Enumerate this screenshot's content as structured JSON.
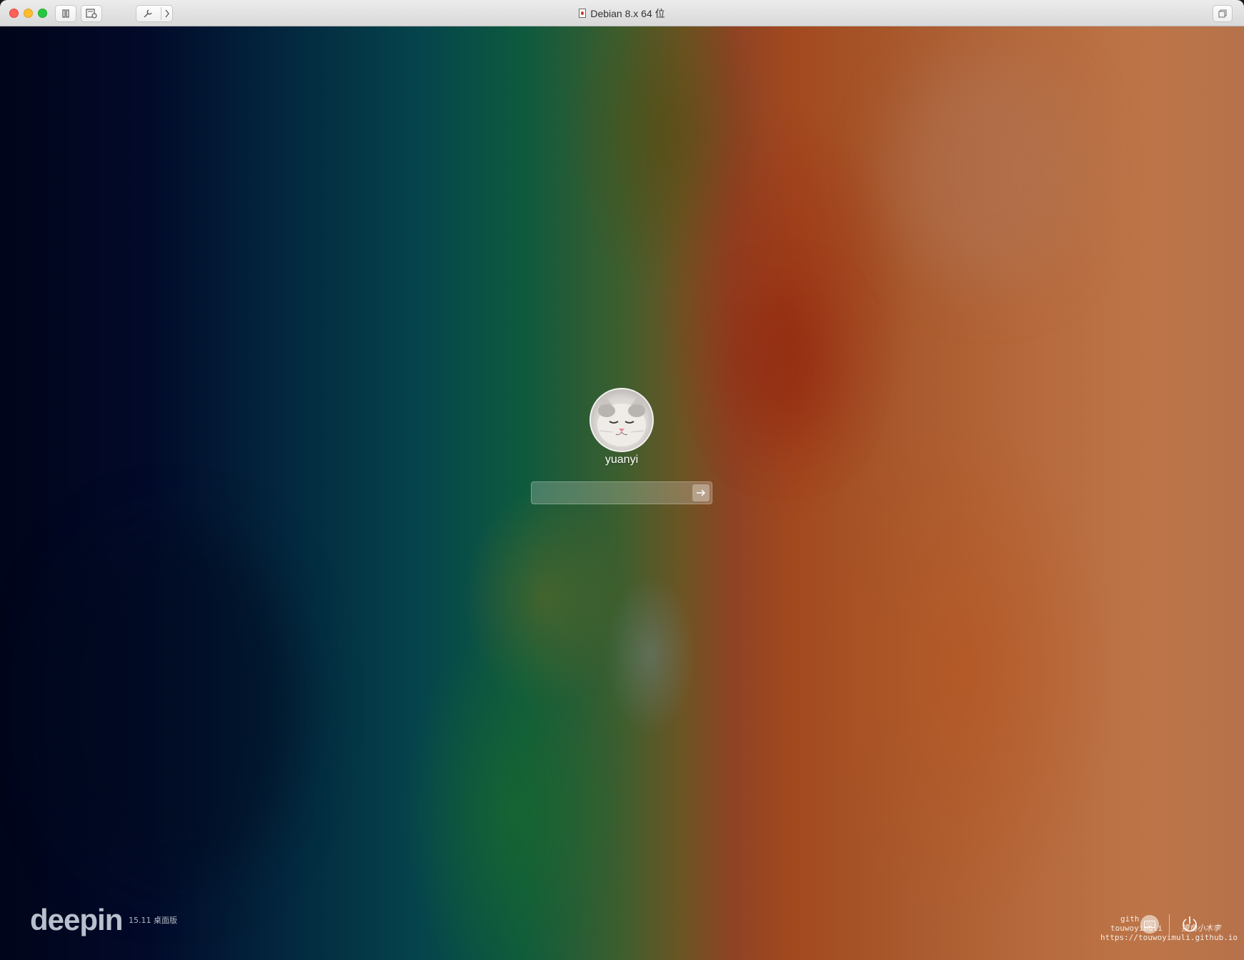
{
  "window": {
    "title": "Debian 8.x 64 位"
  },
  "toolbar": {
    "buttons": [
      {
        "name": "pause-button",
        "icon": "pause-icon"
      },
      {
        "name": "snapshot-button",
        "icon": "snapshot-icon"
      },
      {
        "name": "settings-button",
        "icon": "wrench-icon"
      },
      {
        "name": "more-button",
        "icon": "chevron-right-icon"
      },
      {
        "name": "fullscreen-button",
        "icon": "restore-window-icon"
      }
    ]
  },
  "login": {
    "username": "yuanyi",
    "password_value": "",
    "submit_icon": "arrow-right-icon"
  },
  "branding": {
    "logo": "deepin",
    "version": "15.11 桌面版"
  },
  "tray": {
    "keyboard_icon": "keyboard-icon",
    "power_icon": "power-icon"
  },
  "watermark": {
    "line1": "gith",
    "line2": "touwoyimuli",
    "line3": "https://touwoyimuli.github.io",
    "signature": "摸鱼小木李"
  },
  "colors": {
    "traffic_close": "#fe5f57",
    "traffic_minimize": "#febc2e",
    "traffic_maximize": "#28c840"
  }
}
